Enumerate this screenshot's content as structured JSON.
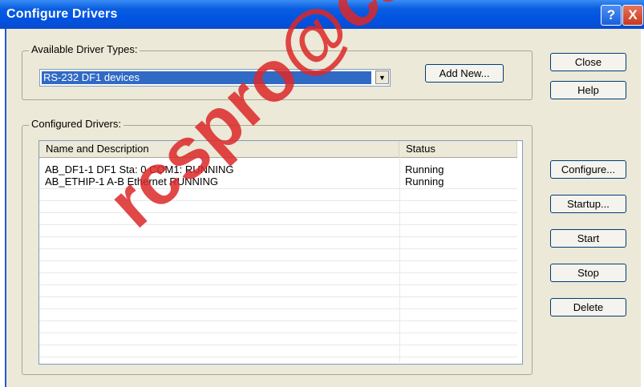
{
  "window": {
    "title": "Configure Drivers",
    "help_glyph": "?",
    "close_glyph": "X"
  },
  "available": {
    "group_label": "Available Driver Types:",
    "selected_driver": "RS-232 DF1 devices",
    "add_new_label": "Add New..."
  },
  "configured": {
    "group_label": "Configured Drivers:",
    "columns": [
      "Name and Description",
      "Status"
    ],
    "rows": [
      {
        "name": "AB_DF1-1  DF1 Sta: 0 COM1: RUNNING",
        "status": "Running"
      },
      {
        "name": "AB_ETHIP-1  A-B Ethernet  RUNNING",
        "status": "Running"
      }
    ]
  },
  "buttons": {
    "close": "Close",
    "help": "Help",
    "configure": "Configure...",
    "startup": "Startup...",
    "start": "Start",
    "stop": "Stop",
    "delete": "Delete"
  },
  "watermark": "rcspro@cambia"
}
